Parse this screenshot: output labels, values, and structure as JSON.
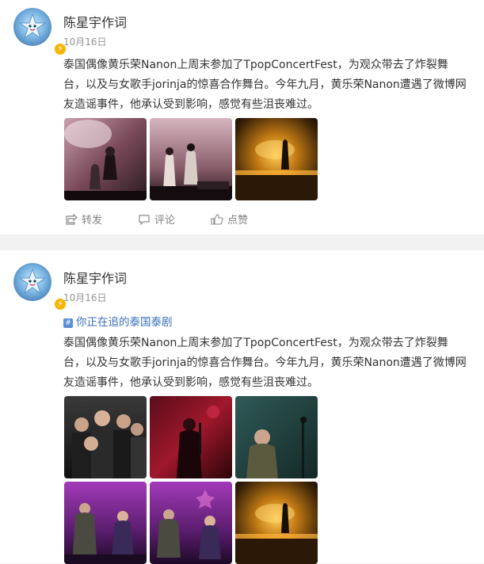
{
  "posts": [
    {
      "author": "陈星宇作词",
      "time": "10月16日",
      "text": "泰国偶像黄乐荣Nanon上周末参加了TpopConcertFest，为观众带去了炸裂舞\n台，以及与女歌手jorinja的惊喜合作舞台。今年九月，黄乐荣Nanon遭遇了微博网\n友造谣事件，他承认受到影响，感觉有些沮丧难过。",
      "actions": {
        "repost": "转发",
        "comment": "评论",
        "like": "点赞"
      }
    },
    {
      "author": "陈星宇作词",
      "time": "10月16日",
      "topic": "你正在追的泰国泰剧",
      "text": "泰国偶像黄乐荣Nanon上周末参加了TpopConcertFest，为观众带去了炸裂舞\n台，以及与女歌手jorinja的惊喜合作舞台。今年九月，黄乐荣Nanon遭遇了微博网\n友造谣事件，他承认受到影响，感觉有些沮丧难过。"
    }
  ],
  "colors": {
    "link": "#3b6fb8",
    "badge": "#f7b500",
    "muted": "#939393"
  },
  "icons": {
    "repost": "repost-icon",
    "comment": "comment-icon",
    "like": "thumbs-up-icon",
    "topic": "topic-hash-icon",
    "verified": "verified-badge-icon"
  }
}
